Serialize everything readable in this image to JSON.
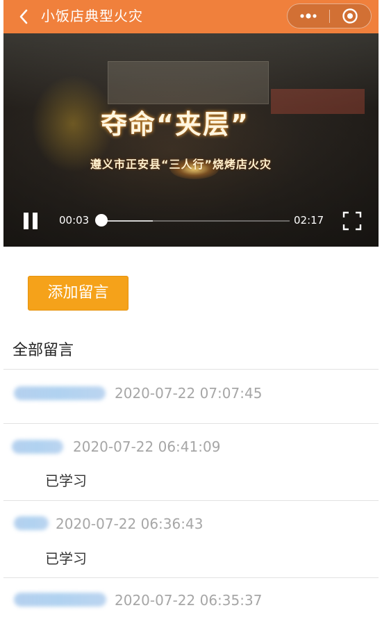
{
  "navbar": {
    "title": "小饭店典型火灾",
    "back_icon": "chevron-left-icon",
    "more_icon": "more-dots-icon",
    "close_icon": "target-circle-icon",
    "bg_color": "#f0803c"
  },
  "video": {
    "headline": "夺命“夹层”",
    "subline": "遵义市正安县“三人行”烧烤店火灾",
    "current_time": "00:03",
    "total_time": "02:17",
    "progress_fraction": 0.022,
    "buffered_fraction": 0.27,
    "state": "playing"
  },
  "actions": {
    "add_comment_label": "添加留言",
    "accent_color": "#f5a21a"
  },
  "comments_section": {
    "title": "全部留言",
    "items": [
      {
        "time": "2020-07-22 07:07:45",
        "text": ""
      },
      {
        "time": "2020-07-22 06:41:09",
        "text": "已学习"
      },
      {
        "time": "2020-07-22 06:36:43",
        "text": "已学习"
      },
      {
        "time": "2020-07-22 06:35:37",
        "text": ""
      }
    ]
  }
}
